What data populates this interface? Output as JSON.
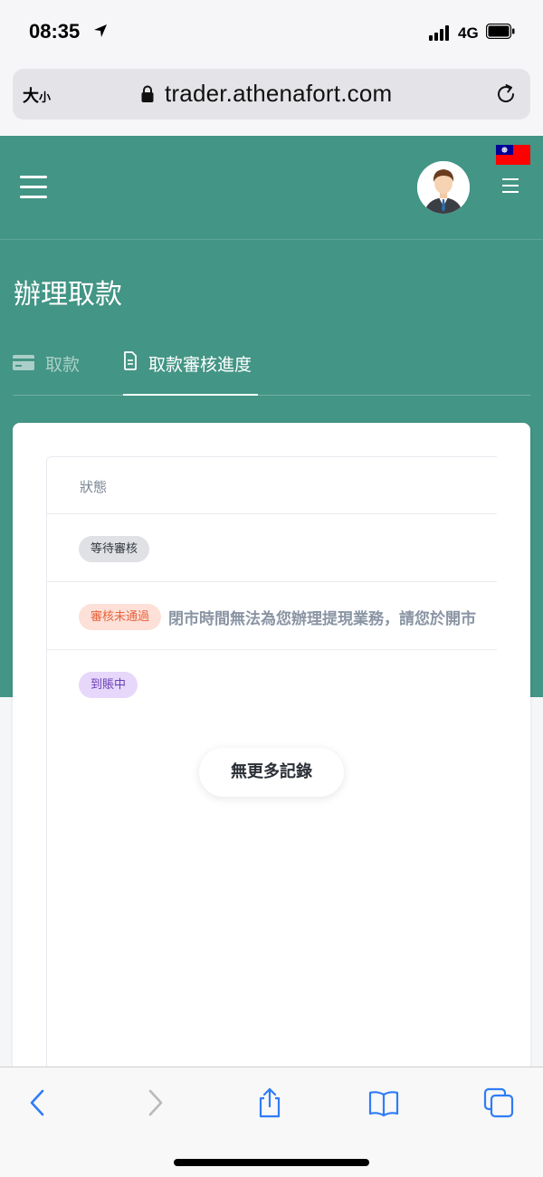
{
  "status_bar": {
    "time": "08:35",
    "network": "4G"
  },
  "browser": {
    "text_size_label": "大",
    "text_size_small": "小",
    "url": "trader.athenafort.com"
  },
  "header": {
    "flag_icon": "taiwan-flag-icon",
    "avatar_icon": "user-avatar-icon"
  },
  "page": {
    "title": "辦理取款",
    "tabs": [
      {
        "label": "取款",
        "icon": "credit-card-icon",
        "active": false
      },
      {
        "label": "取款審核進度",
        "icon": "document-icon",
        "active": true
      }
    ]
  },
  "table": {
    "column_header": "狀態",
    "rows": [
      {
        "status": "等待審核",
        "status_color": "#dfe1e5"
      },
      {
        "status": "審核未通過",
        "status_color": "#fde0d8",
        "reason": "閉市時間無法為您辦理提現業務，請您於開市"
      },
      {
        "status": "到賬中",
        "status_color": "#e6d7fb"
      }
    ]
  },
  "no_more_label": "無更多記錄",
  "colors": {
    "brand": "#439585"
  }
}
